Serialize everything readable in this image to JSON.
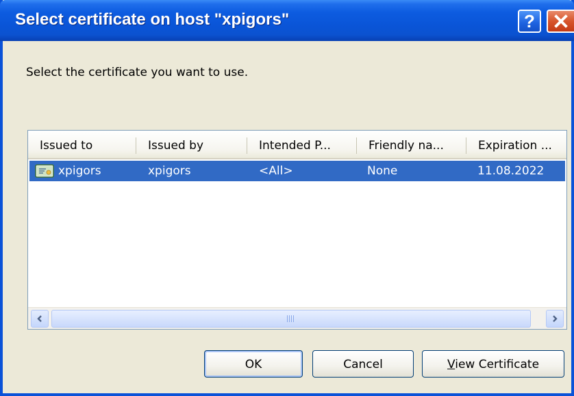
{
  "window": {
    "title": "Select certificate on host \"xpigors\"",
    "help_label": "?",
    "accent": "#0a55d8",
    "close_color": "#d7552c"
  },
  "prompt": "Select the certificate you want to use.",
  "list": {
    "columns": [
      "Issued to",
      "Issued by",
      "Intended P...",
      "Friendly na...",
      "Expiration ..."
    ],
    "rows": [
      {
        "icon": "certificate-icon",
        "cells": [
          "xpigors",
          "xpigors",
          "<All>",
          "None",
          "11.08.2022"
        ],
        "selected": true
      }
    ],
    "selection_color": "#316ac5"
  },
  "scrollbar": {
    "left_icon": "arrow-left-icon",
    "right_icon": "arrow-right-icon"
  },
  "buttons": {
    "ok": "OK",
    "cancel": "Cancel",
    "view_certificate": "View Certificate"
  }
}
